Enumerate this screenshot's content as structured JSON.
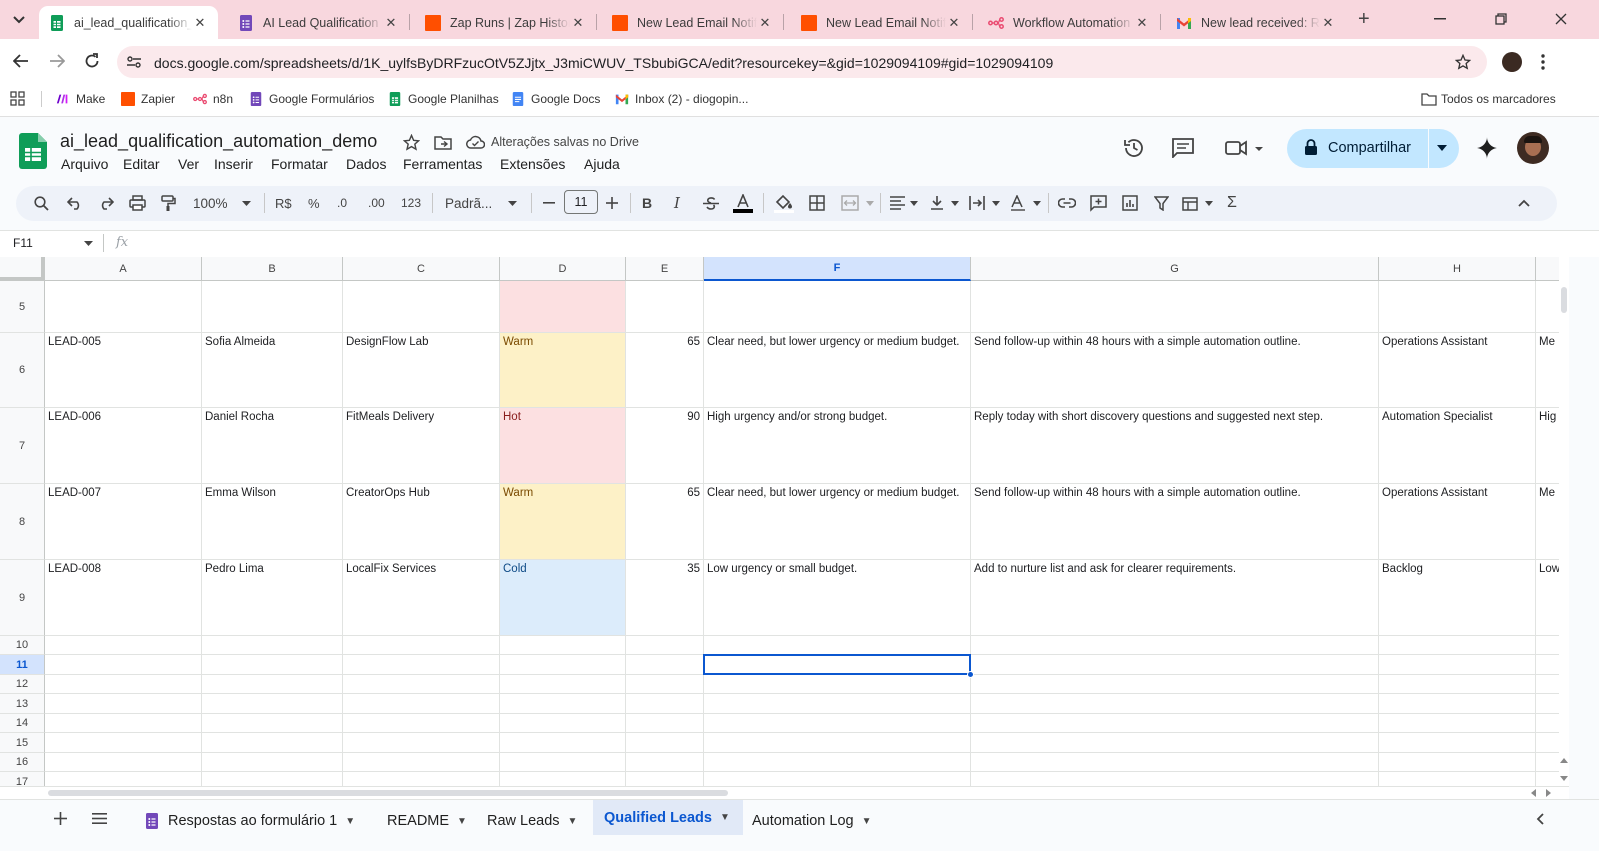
{
  "browser": {
    "tabs": [
      {
        "title": "ai_lead_qualification_automation_demo",
        "icon": "google-sheets-icon",
        "active": true
      },
      {
        "title": "AI Lead Qualification Form",
        "icon": "google-forms-icon",
        "active": false
      },
      {
        "title": "Zap Runs | Zap History",
        "icon": "zapier-icon",
        "active": false
      },
      {
        "title": "New Lead Email Notification",
        "icon": "zapier-icon",
        "active": false
      },
      {
        "title": "New Lead Email Notification",
        "icon": "zapier-icon",
        "active": false
      },
      {
        "title": "Workflow Automation",
        "icon": "n8n-icon",
        "active": false
      },
      {
        "title": "New lead received: Rafael",
        "icon": "gmail-icon",
        "active": false
      }
    ],
    "url": "docs.google.com/spreadsheets/d/1K_uylfsByDRFzucOtV5ZJjtx_J3miCWUV_TSbubiGCA/edit?resourcekey=&gid=1029094109#gid=1029094109",
    "bookmarks": [
      {
        "label": "Make",
        "icon": "make-icon"
      },
      {
        "label": "Zapier",
        "icon": "zapier-icon"
      },
      {
        "label": "n8n",
        "icon": "n8n-icon"
      },
      {
        "label": "Google Formulários",
        "icon": "google-forms-icon"
      },
      {
        "label": "Google Planilhas",
        "icon": "google-sheets-icon"
      },
      {
        "label": "Google Docs",
        "icon": "google-docs-icon"
      },
      {
        "label": "Inbox (2) - diogopin...",
        "icon": "gmail-icon"
      }
    ],
    "all_bookmarks": "Todos os marcadores"
  },
  "sheets": {
    "doc_title": "ai_lead_qualification_automation_demo",
    "saved_status": "Alterações salvas no Drive",
    "menu": [
      "Arquivo",
      "Editar",
      "Ver",
      "Inserir",
      "Formatar",
      "Dados",
      "Ferramentas",
      "Extensões",
      "Ajuda"
    ],
    "share_label": "Compartilhar",
    "toolbar": {
      "zoom": "100%",
      "currency": "R$",
      "percent": "%",
      "dec_less": ".0",
      "dec_more": ".00",
      "number_format": "123",
      "font": "Padrã...",
      "font_size": "11"
    },
    "name_box": "F11",
    "fx": "fx"
  },
  "grid": {
    "columns": [
      "A",
      "B",
      "C",
      "D",
      "E",
      "F",
      "G",
      "H",
      ""
    ],
    "selected_column": "F",
    "selected_row": "11",
    "rows": [
      {
        "num": "5",
        "cells": [
          "",
          "",
          "",
          "",
          "",
          "",
          "",
          "",
          ""
        ],
        "status": "hot"
      },
      {
        "num": "6",
        "cells": [
          "LEAD-005",
          "Sofia Almeida",
          "DesignFlow Lab",
          "Warm",
          "65",
          "Clear need, but lower urgency or medium budget.",
          "Send follow-up within 48 hours with a simple automation outline.",
          "Operations Assistant",
          "Me"
        ],
        "status": "warm"
      },
      {
        "num": "7",
        "cells": [
          "LEAD-006",
          "Daniel Rocha",
          "FitMeals Delivery",
          "Hot",
          "90",
          "High urgency and/or strong budget.",
          "Reply today with short discovery questions and suggested next step.",
          "Automation Specialist",
          "Hig"
        ],
        "status": "hot"
      },
      {
        "num": "8",
        "cells": [
          "LEAD-007",
          "Emma Wilson",
          "CreatorOps Hub",
          "Warm",
          "65",
          "Clear need, but lower urgency or medium budget.",
          "Send follow-up within 48 hours with a simple automation outline.",
          "Operations Assistant",
          "Me"
        ],
        "status": "warm"
      },
      {
        "num": "9",
        "cells": [
          "LEAD-008",
          "Pedro Lima",
          "LocalFix Services",
          "Cold",
          "35",
          "Low urgency or small budget.",
          "Add to nurture list and ask for clearer requirements.",
          "Backlog",
          "Low"
        ],
        "status": "cold"
      },
      {
        "num": "10",
        "cells": [
          "",
          "",
          "",
          "",
          "",
          "",
          "",
          "",
          ""
        ],
        "status": ""
      },
      {
        "num": "11",
        "cells": [
          "",
          "",
          "",
          "",
          "",
          "",
          "",
          "",
          ""
        ],
        "status": ""
      },
      {
        "num": "12",
        "cells": [
          "",
          "",
          "",
          "",
          "",
          "",
          "",
          "",
          ""
        ],
        "status": ""
      },
      {
        "num": "13",
        "cells": [
          "",
          "",
          "",
          "",
          "",
          "",
          "",
          "",
          ""
        ],
        "status": ""
      },
      {
        "num": "14",
        "cells": [
          "",
          "",
          "",
          "",
          "",
          "",
          "",
          "",
          ""
        ],
        "status": ""
      },
      {
        "num": "15",
        "cells": [
          "",
          "",
          "",
          "",
          "",
          "",
          "",
          "",
          ""
        ],
        "status": ""
      },
      {
        "num": "16",
        "cells": [
          "",
          "",
          "",
          "",
          "",
          "",
          "",
          "",
          ""
        ],
        "status": ""
      },
      {
        "num": "17",
        "cells": [
          "",
          "",
          "",
          "",
          "",
          "",
          "",
          "",
          ""
        ],
        "status": ""
      }
    ],
    "status_colors": {
      "hot": {
        "bg": "#fce0e1",
        "fg": "#8a1c1c"
      },
      "warm": {
        "bg": "#fdf1c7",
        "fg": "#7a4a00"
      },
      "cold": {
        "bg": "#dcecfb",
        "fg": "#0d4a86"
      }
    }
  },
  "sheet_tabs": [
    {
      "label": "Respostas ao formulário 1",
      "icon": "google-forms-icon",
      "active": false
    },
    {
      "label": "README",
      "active": false
    },
    {
      "label": "Raw Leads",
      "active": false
    },
    {
      "label": "Qualified Leads",
      "active": true
    },
    {
      "label": "Automation Log",
      "active": false
    }
  ]
}
